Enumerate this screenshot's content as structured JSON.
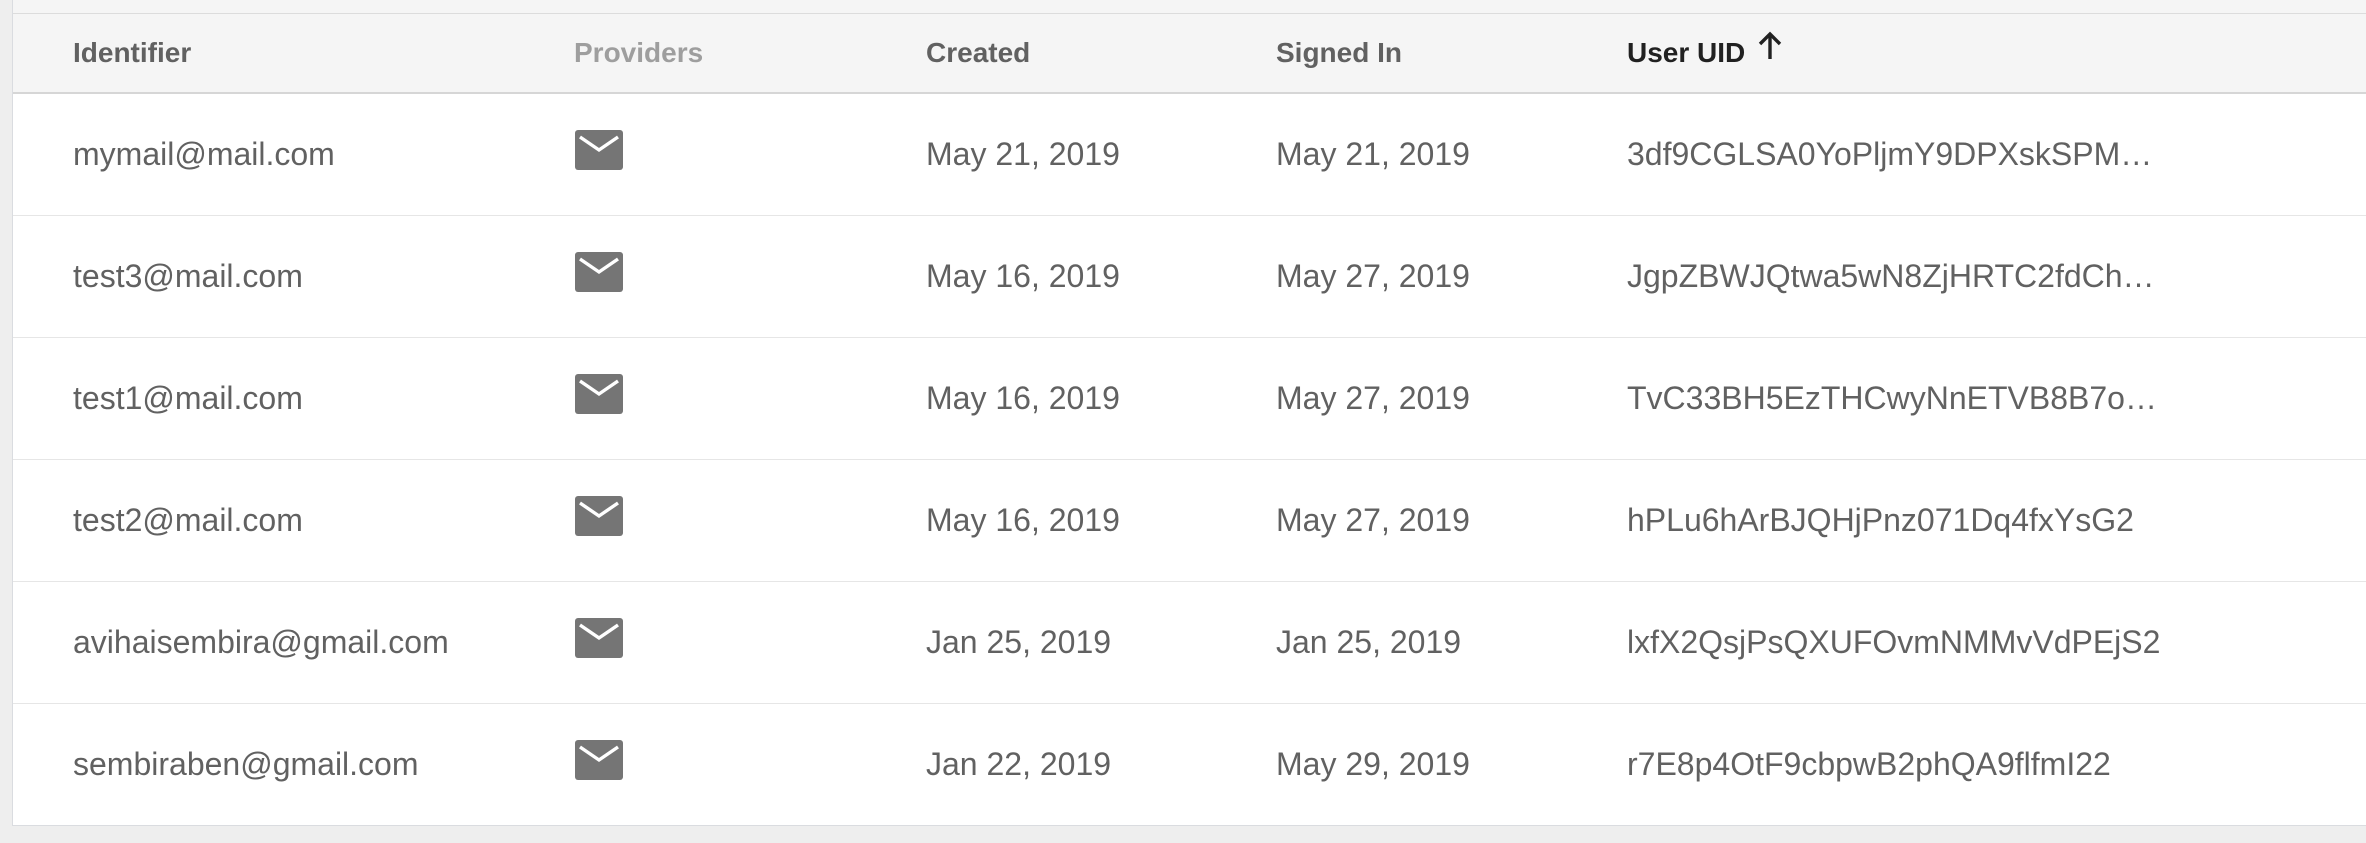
{
  "table": {
    "columns": {
      "identifier": "Identifier",
      "providers": "Providers",
      "created": "Created",
      "signed_in": "Signed In",
      "user_uid": "User UID"
    },
    "sort": {
      "column": "User UID",
      "direction": "ascending",
      "icon": "arrow-up-icon"
    },
    "rows": [
      {
        "identifier": "mymail@mail.com",
        "provider_icon": "mail-icon",
        "created": "May 21, 2019",
        "signed_in": "May 21, 2019",
        "uid": "3df9CGLSA0YoPljmY9DPXskSPM…"
      },
      {
        "identifier": "test3@mail.com",
        "provider_icon": "mail-icon",
        "created": "May 16, 2019",
        "signed_in": "May 27, 2019",
        "uid": "JgpZBWJQtwa5wN8ZjHRTC2fdCh…"
      },
      {
        "identifier": "test1@mail.com",
        "provider_icon": "mail-icon",
        "created": "May 16, 2019",
        "signed_in": "May 27, 2019",
        "uid": "TvC33BH5EzTHCwyNnETVB8B7o…"
      },
      {
        "identifier": "test2@mail.com",
        "provider_icon": "mail-icon",
        "created": "May 16, 2019",
        "signed_in": "May 27, 2019",
        "uid": "hPLu6hArBJQHjPnz071Dq4fxYsG2"
      },
      {
        "identifier": "avihaisembira@gmail.com",
        "provider_icon": "mail-icon",
        "created": "Jan 25, 2019",
        "signed_in": "Jan 25, 2019",
        "uid": "lxfX2QsjPsQXUFOvmNMMvVdPEjS2"
      },
      {
        "identifier": "sembiraben@gmail.com",
        "provider_icon": "mail-icon",
        "created": "Jan 22, 2019",
        "signed_in": "May 29, 2019",
        "uid": "r7E8p4OtF9cbpwB2phQA9flfmI22"
      }
    ]
  },
  "colors": {
    "header_bg": "#f5f5f5",
    "text": "#616161",
    "header_muted": "#9e9e9e",
    "header_active": "#212121",
    "icon": "#757575"
  }
}
